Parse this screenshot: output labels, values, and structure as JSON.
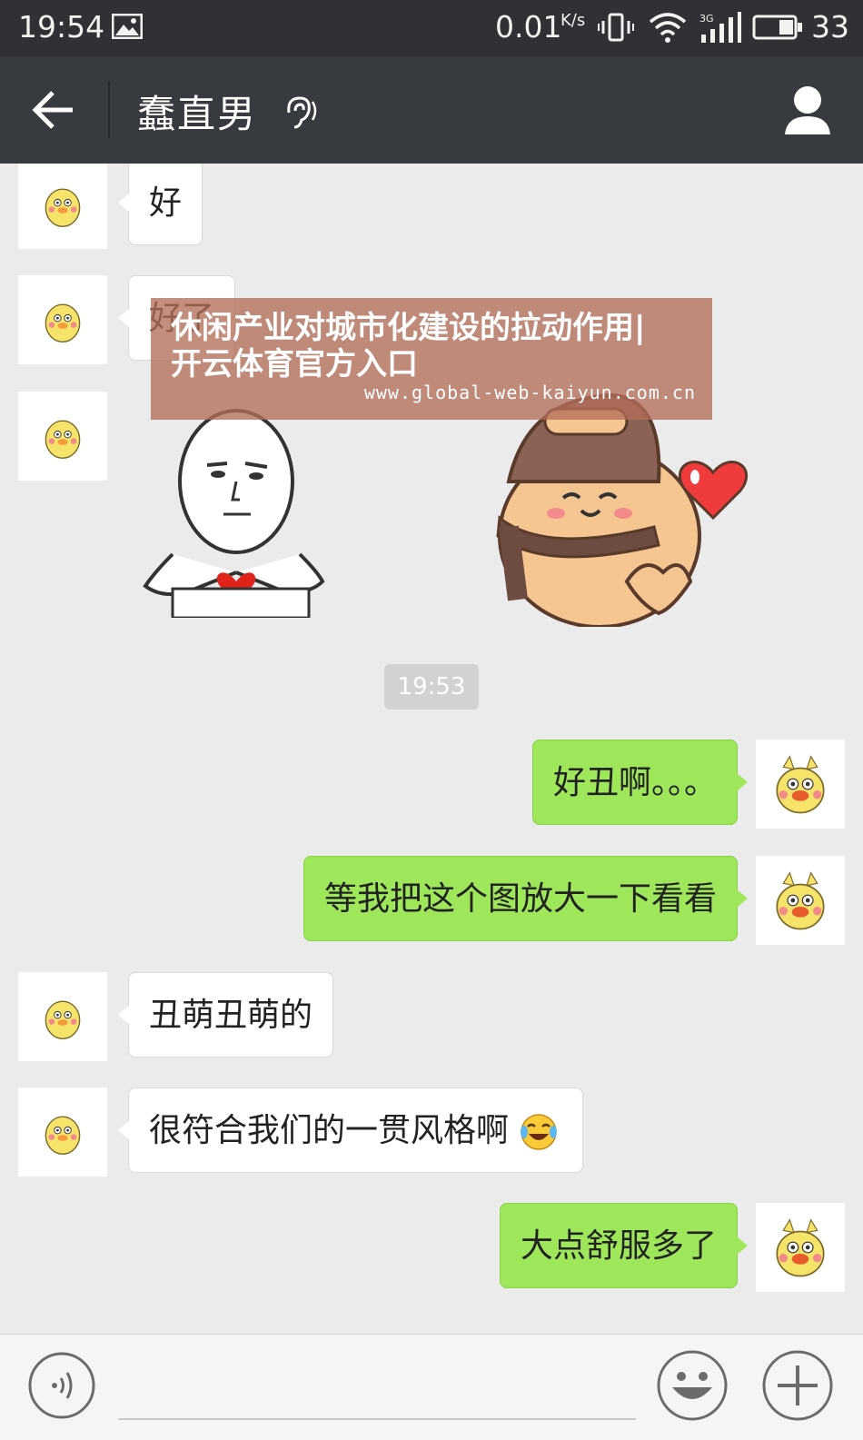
{
  "status_bar": {
    "time": "19:54",
    "net_speed": "0.01",
    "speed_unit": "K/s",
    "battery": "33",
    "icons": [
      "image-icon",
      "vibrate-icon",
      "wifi-icon",
      "3g-signal-icon",
      "battery-icon"
    ]
  },
  "title_bar": {
    "contact_name": "蠢直男",
    "icons": [
      "back-arrow-icon",
      "earpiece-icon",
      "contact-profile-icon"
    ]
  },
  "messages": [
    {
      "side": "left",
      "type": "text",
      "text": "好"
    },
    {
      "side": "left",
      "type": "text",
      "text": "好了"
    },
    {
      "side": "left",
      "type": "sticker",
      "sticker": "meme-face-heart-sticker"
    },
    {
      "side": "left",
      "type": "sticker",
      "sticker": "hat-blob-heart-sticker"
    },
    {
      "type": "timestamp",
      "text": "19:53"
    },
    {
      "side": "right",
      "type": "text",
      "text": "好丑啊。。。"
    },
    {
      "side": "right",
      "type": "text",
      "text": "等我把这个图放大一下看看"
    },
    {
      "side": "left",
      "type": "text",
      "text": "丑萌丑萌的"
    },
    {
      "side": "left",
      "type": "text",
      "text": "很符合我们的一贯风格啊",
      "emoji": "laughing-cry-emoji"
    },
    {
      "side": "right",
      "type": "text",
      "text": "大点舒服多了"
    }
  ],
  "watermark": {
    "line1": "休闲产业对城市化建设的拉动作用|",
    "line2": "开云体育官方入口",
    "url": "www.global-web-kaiyun.com.cn"
  },
  "input_bar": {
    "icons": [
      "voice-input-icon",
      "emoji-icon",
      "plus-icon"
    ]
  },
  "colors": {
    "title_bg": "#373a3e",
    "status_bg": "#2f3134",
    "chat_bg": "#ebebeb",
    "sent_bubble": "#9ee75b",
    "received_bubble": "#ffffff"
  }
}
